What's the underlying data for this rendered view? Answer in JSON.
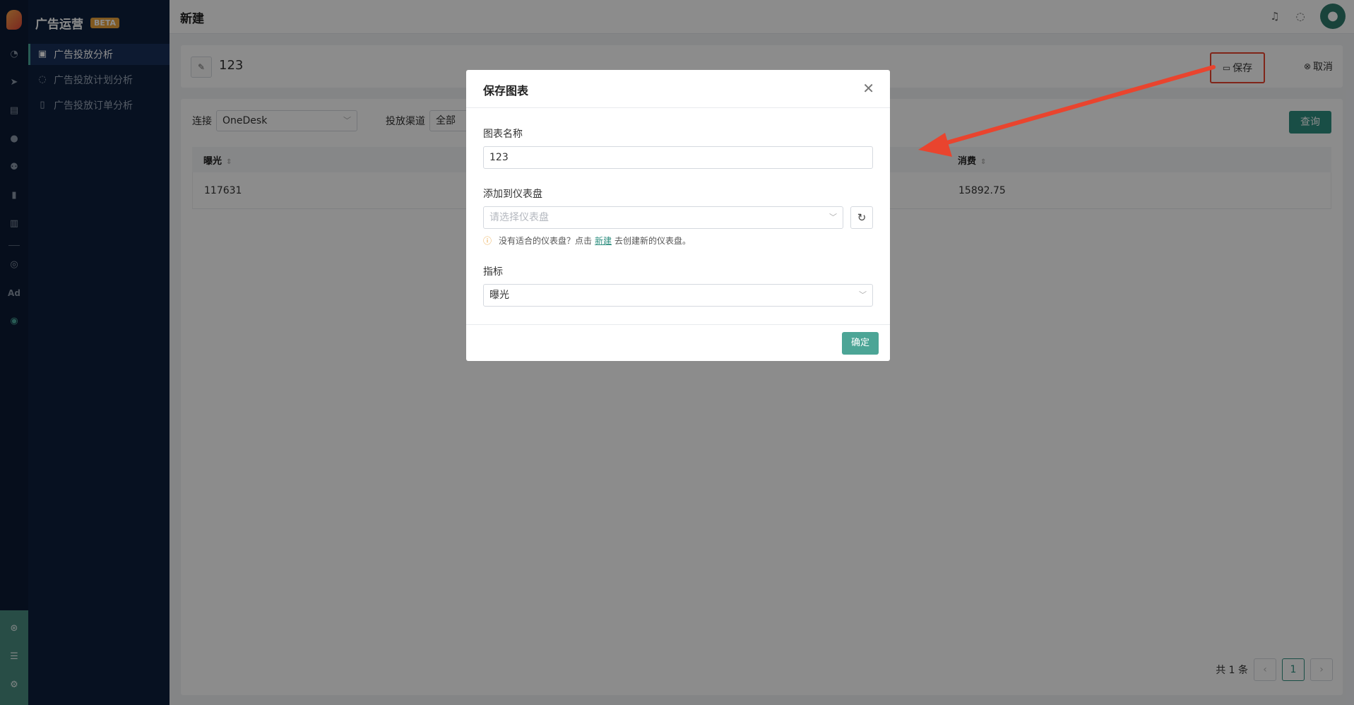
{
  "sidebar": {
    "title": "广告运营",
    "beta": "BETA",
    "items": [
      {
        "label": "广告投放分析"
      },
      {
        "label": "广告投放计划分析"
      },
      {
        "label": "广告投放订单分析"
      }
    ],
    "rail_ad_label": "Ad"
  },
  "header": {
    "title": "新建"
  },
  "toolbar": {
    "chart_name": "123",
    "save_label": "保存",
    "cancel_label": "取消"
  },
  "filters": {
    "connection_label": "连接",
    "connection_value": "OneDesk",
    "channel_label": "投放渠道",
    "channel_value": "全部",
    "query_label": "查询"
  },
  "table": {
    "headers": [
      "曝光",
      "消费"
    ],
    "rows": [
      [
        "117631",
        "15892.75"
      ]
    ]
  },
  "pagination": {
    "total_text": "共 1 条",
    "current_page": "1"
  },
  "modal": {
    "title": "保存图表",
    "name_label": "图表名称",
    "name_value": "123",
    "dashboard_label": "添加到仪表盘",
    "dashboard_placeholder": "请选择仪表盘",
    "hint_prefix": "没有适合的仪表盘？点击",
    "hint_link": "新建",
    "hint_suffix": "去创建新的仪表盘。",
    "metric_label": "指标",
    "metric_value": "曝光",
    "ok_label": "确定"
  },
  "colors": {
    "accent": "#2f8f80",
    "annotation": "#e9442e",
    "sidebar_bg": "#0d1f3c"
  }
}
